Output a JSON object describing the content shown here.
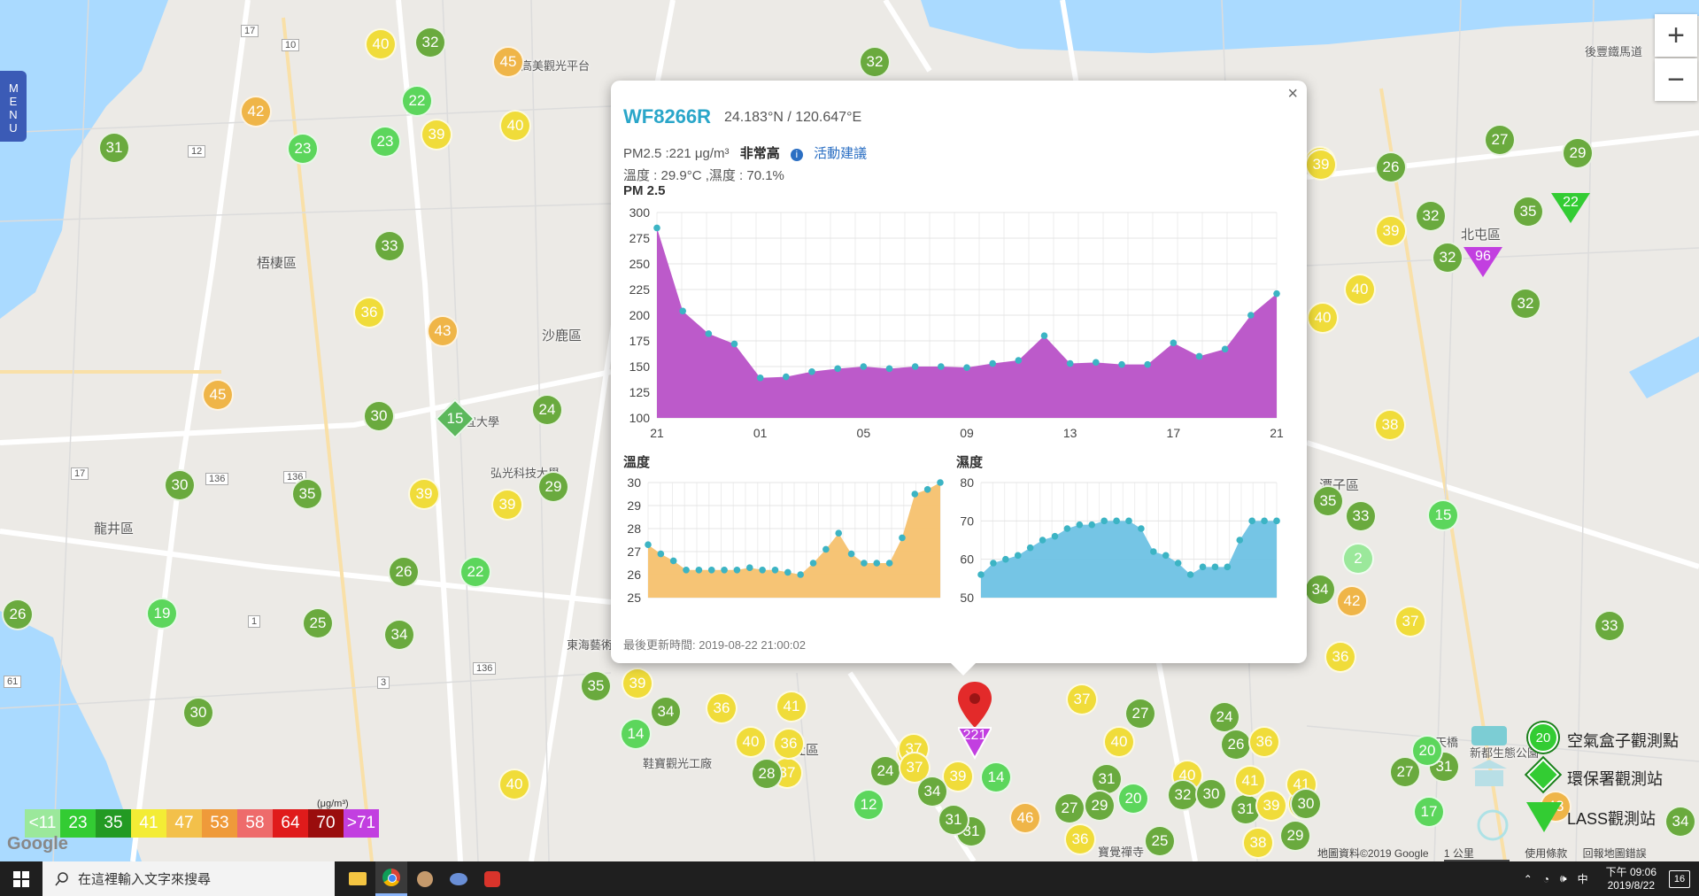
{
  "menu": {
    "label": "MENU"
  },
  "zoom": {
    "in": "+",
    "out": "−"
  },
  "map": {
    "districts": [
      "梧棲區",
      "沙鹿區",
      "龍井區",
      "北屯區",
      "潭子區",
      "大肚區"
    ],
    "poi": [
      "高美觀光平台",
      "靜宜大學",
      "弘光科技大學",
      "東海藝術",
      "鞋寶觀光工廠",
      "後豐鐵馬道",
      "海天橋",
      "新都生態公園",
      "寶覺禪寺"
    ],
    "road_numbers": [
      "17",
      "10",
      "12",
      "136",
      "136",
      "1",
      "17",
      "3",
      "136",
      "61"
    ]
  },
  "markers": {
    "circles": [
      "40",
      "32",
      "45",
      "42",
      "22",
      "23",
      "23",
      "39",
      "40",
      "31",
      "33",
      "36",
      "43",
      "45",
      "30",
      "24",
      "30",
      "35",
      "39",
      "39",
      "29",
      "26",
      "22",
      "26",
      "19",
      "25",
      "34",
      "30",
      "35",
      "39",
      "34",
      "36",
      "41",
      "40",
      "37",
      "36",
      "40",
      "32",
      "27",
      "29",
      "32",
      "35",
      "39",
      "26",
      "32",
      "32",
      "39",
      "39",
      "40",
      "40",
      "38",
      "35",
      "33",
      "15",
      "2",
      "34",
      "42",
      "37",
      "36",
      "33",
      "37",
      "27",
      "40",
      "24",
      "26",
      "36",
      "31",
      "40",
      "31",
      "29",
      "20",
      "32",
      "30",
      "27",
      "31",
      "41",
      "39",
      "38",
      "41",
      "30",
      "17",
      "43",
      "34",
      "20",
      "14",
      "28",
      "36",
      "37",
      "24",
      "37",
      "39",
      "14",
      "34",
      "31",
      "12",
      "31",
      "46",
      "27",
      "36",
      "25",
      "38",
      "29"
    ],
    "diamond": "15",
    "triangles": [
      "96",
      "22"
    ]
  },
  "popup": {
    "close": "×",
    "station_id": "WF8266R",
    "coords": "24.183°N / 120.647°E",
    "pm_text": "PM2.5 :221 μg/m³",
    "level": "非常高",
    "advice_link": "活動建議",
    "info_icon": "i",
    "temp_humid_text": "溫度 : 29.9°C ,濕度 : 70.1%",
    "updated": "最後更新時間: 2019-08-22 21:00:02"
  },
  "pin": {
    "value": "221"
  },
  "chart_data": [
    {
      "type": "area",
      "title": "PM 2.5",
      "color": "#b851c7",
      "xticks": [
        "21",
        "01",
        "05",
        "09",
        "13",
        "17",
        "21"
      ],
      "ylim": [
        100,
        300
      ],
      "yticks": [
        100,
        125,
        150,
        175,
        200,
        225,
        250,
        275,
        300
      ],
      "x": [
        0,
        1,
        2,
        3,
        4,
        5,
        6,
        7,
        8,
        9,
        10,
        11,
        12,
        13,
        14,
        15,
        16,
        17,
        18,
        19,
        20,
        21,
        22,
        23,
        24
      ],
      "values": [
        285,
        204,
        182,
        172,
        139,
        140,
        145,
        148,
        150,
        148,
        150,
        150,
        149,
        153,
        156,
        180,
        153,
        154,
        152,
        152,
        173,
        160,
        167,
        200,
        221
      ]
    },
    {
      "type": "area",
      "title": "溫度",
      "color": "#f5c16e",
      "ylim": [
        25,
        30
      ],
      "yticks": [
        25,
        26,
        27,
        28,
        29,
        30
      ],
      "values": [
        27.3,
        26.9,
        26.6,
        26.2,
        26.2,
        26.2,
        26.2,
        26.2,
        26.3,
        26.2,
        26.2,
        26.1,
        26.0,
        26.5,
        27.1,
        27.8,
        26.9,
        26.5,
        26.5,
        26.5,
        27.6,
        29.5,
        29.7,
        30.0
      ]
    },
    {
      "type": "area",
      "title": "濕度",
      "color": "#6ec2e4",
      "ylim": [
        50,
        80
      ],
      "yticks": [
        50,
        60,
        70,
        80
      ],
      "values": [
        56,
        59,
        60,
        61,
        63,
        65,
        66,
        68,
        69,
        69,
        70,
        70,
        70,
        68,
        62,
        61,
        59,
        56,
        58,
        58,
        58,
        65,
        70,
        70,
        70
      ]
    }
  ],
  "scale": {
    "unit": "(μg/m³)",
    "labels": [
      "<11",
      "23",
      "35",
      "41",
      "47",
      "53",
      "58",
      "64",
      "70",
      ">71"
    ],
    "colors": [
      "#9be89b",
      "#33cc33",
      "#239a23",
      "#f3ec35",
      "#f3c04a",
      "#ef9a3a",
      "#ee6b6b",
      "#e01b1b",
      "#9a0d0d",
      "#c23fe0"
    ]
  },
  "legend": {
    "items": [
      "空氣盒子觀測點",
      "環保署觀測站",
      "LASS觀測站"
    ],
    "icon_value": "20"
  },
  "attribution": {
    "data": "地圖資料©2019 Google",
    "scale": "1 公里",
    "terms": "使用條款",
    "report": "回報地圖錯誤"
  },
  "google": "Google",
  "taskbar": {
    "search_placeholder": "在這裡輸入文字來搜尋",
    "ime": "中",
    "time": "下午 09:06",
    "date": "2019/8/22",
    "notifications": "16"
  }
}
